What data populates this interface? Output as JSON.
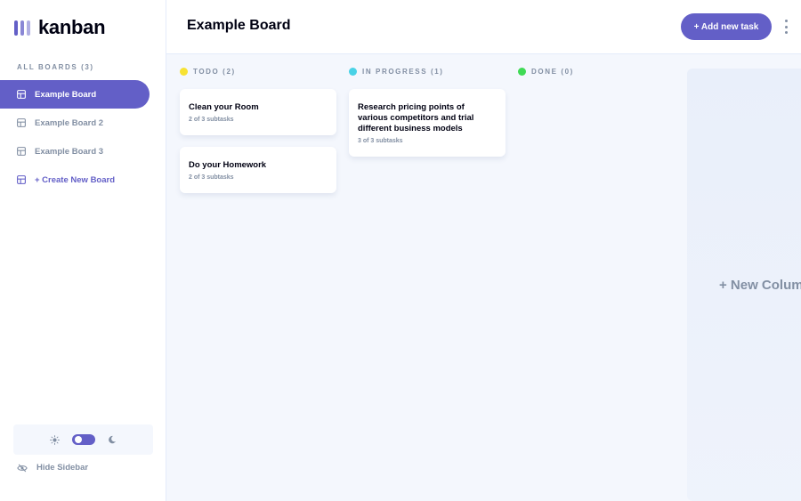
{
  "app": {
    "logo_text": "kanban"
  },
  "sidebar": {
    "boards_heading": "ALL BOARDS (3)",
    "boards": [
      {
        "label": "Example Board",
        "active": true
      },
      {
        "label": "Example Board 2",
        "active": false
      },
      {
        "label": "Example Board 3",
        "active": false
      }
    ],
    "create_label": "+ Create New Board",
    "hide_label": "Hide Sidebar",
    "theme": {
      "mode": "light"
    }
  },
  "header": {
    "board_title": "Example Board",
    "add_task_label": "+ Add new task"
  },
  "columns": [
    {
      "name": "TODO (2)",
      "color": "#F7E233",
      "tasks": [
        {
          "title": "Clean your Room",
          "subtasks": "2 of 3 subtasks"
        },
        {
          "title": "Do your Homework",
          "subtasks": "2 of 3 subtasks"
        }
      ]
    },
    {
      "name": "IN PROGRESS (1)",
      "color": "#49D2E6",
      "tasks": [
        {
          "title": "Research pricing points of various competitors and trial different business models",
          "subtasks": "3 of 3 subtasks"
        }
      ]
    },
    {
      "name": "DONE (0)",
      "color": "#3FDA55",
      "tasks": []
    }
  ],
  "new_column_label": "+ New Column",
  "colors": {
    "accent": "#635FC7",
    "muted": "#828FA3",
    "background": "#F4F7FD"
  }
}
